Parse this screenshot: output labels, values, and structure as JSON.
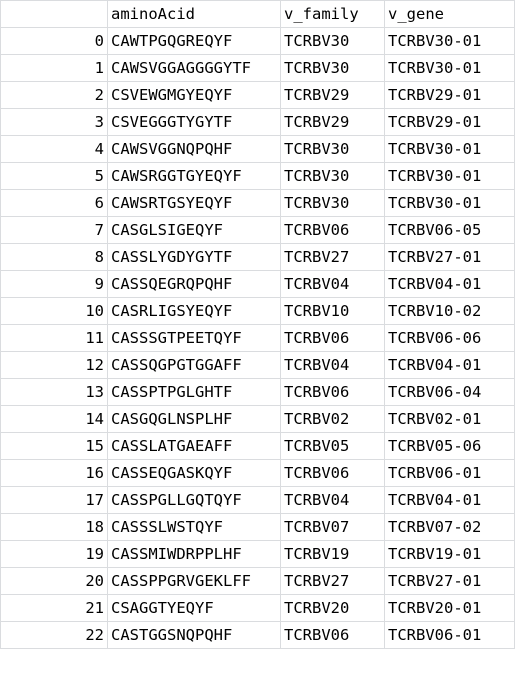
{
  "columns": {
    "index": "",
    "aminoAcid": "aminoAcid",
    "v_family": "v_family",
    "v_gene": "v_gene"
  },
  "rows": [
    {
      "index": "0",
      "aminoAcid": "CAWTPGQGREQYF",
      "v_family": "TCRBV30",
      "v_gene": "TCRBV30-01"
    },
    {
      "index": "1",
      "aminoAcid": "CAWSVGGAGGGGYTF",
      "v_family": "TCRBV30",
      "v_gene": "TCRBV30-01"
    },
    {
      "index": "2",
      "aminoAcid": "CSVEWGMGYEQYF",
      "v_family": "TCRBV29",
      "v_gene": "TCRBV29-01"
    },
    {
      "index": "3",
      "aminoAcid": "CSVEGGGTYGYTF",
      "v_family": "TCRBV29",
      "v_gene": "TCRBV29-01"
    },
    {
      "index": "4",
      "aminoAcid": "CAWSVGGNQPQHF",
      "v_family": "TCRBV30",
      "v_gene": "TCRBV30-01"
    },
    {
      "index": "5",
      "aminoAcid": "CAWSRGGTGYEQYF",
      "v_family": "TCRBV30",
      "v_gene": "TCRBV30-01"
    },
    {
      "index": "6",
      "aminoAcid": "CAWSRTGSYEQYF",
      "v_family": "TCRBV30",
      "v_gene": "TCRBV30-01"
    },
    {
      "index": "7",
      "aminoAcid": "CASGLSIGEQYF",
      "v_family": "TCRBV06",
      "v_gene": "TCRBV06-05"
    },
    {
      "index": "8",
      "aminoAcid": "CASSLYGDYGYTF",
      "v_family": "TCRBV27",
      "v_gene": "TCRBV27-01"
    },
    {
      "index": "9",
      "aminoAcid": "CASSQEGRQPQHF",
      "v_family": "TCRBV04",
      "v_gene": "TCRBV04-01"
    },
    {
      "index": "10",
      "aminoAcid": "CASRLIGSYEQYF",
      "v_family": "TCRBV10",
      "v_gene": "TCRBV10-02"
    },
    {
      "index": "11",
      "aminoAcid": "CASSSGTPEETQYF",
      "v_family": "TCRBV06",
      "v_gene": "TCRBV06-06"
    },
    {
      "index": "12",
      "aminoAcid": "CASSQGPGTGGAFF",
      "v_family": "TCRBV04",
      "v_gene": "TCRBV04-01"
    },
    {
      "index": "13",
      "aminoAcid": "CASSPTPGLGHTF",
      "v_family": "TCRBV06",
      "v_gene": "TCRBV06-04"
    },
    {
      "index": "14",
      "aminoAcid": "CASGQGLNSPLHF",
      "v_family": "TCRBV02",
      "v_gene": "TCRBV02-01"
    },
    {
      "index": "15",
      "aminoAcid": "CASSLATGAEAFF",
      "v_family": "TCRBV05",
      "v_gene": "TCRBV05-06"
    },
    {
      "index": "16",
      "aminoAcid": "CASSEQGASKQYF",
      "v_family": "TCRBV06",
      "v_gene": "TCRBV06-01"
    },
    {
      "index": "17",
      "aminoAcid": "CASSPGLLGQTQYF",
      "v_family": "TCRBV04",
      "v_gene": "TCRBV04-01"
    },
    {
      "index": "18",
      "aminoAcid": "CASSSLWSTQYF",
      "v_family": "TCRBV07",
      "v_gene": "TCRBV07-02"
    },
    {
      "index": "19",
      "aminoAcid": "CASSMIWDRPPLHF",
      "v_family": "TCRBV19",
      "v_gene": "TCRBV19-01"
    },
    {
      "index": "20",
      "aminoAcid": "CASSPPGRVGEKLFF",
      "v_family": "TCRBV27",
      "v_gene": "TCRBV27-01"
    },
    {
      "index": "21",
      "aminoAcid": "CSAGGTYEQYF",
      "v_family": "TCRBV20",
      "v_gene": "TCRBV20-01"
    },
    {
      "index": "22",
      "aminoAcid": "CASTGGSNQPQHF",
      "v_family": "TCRBV06",
      "v_gene": "TCRBV06-01"
    }
  ]
}
